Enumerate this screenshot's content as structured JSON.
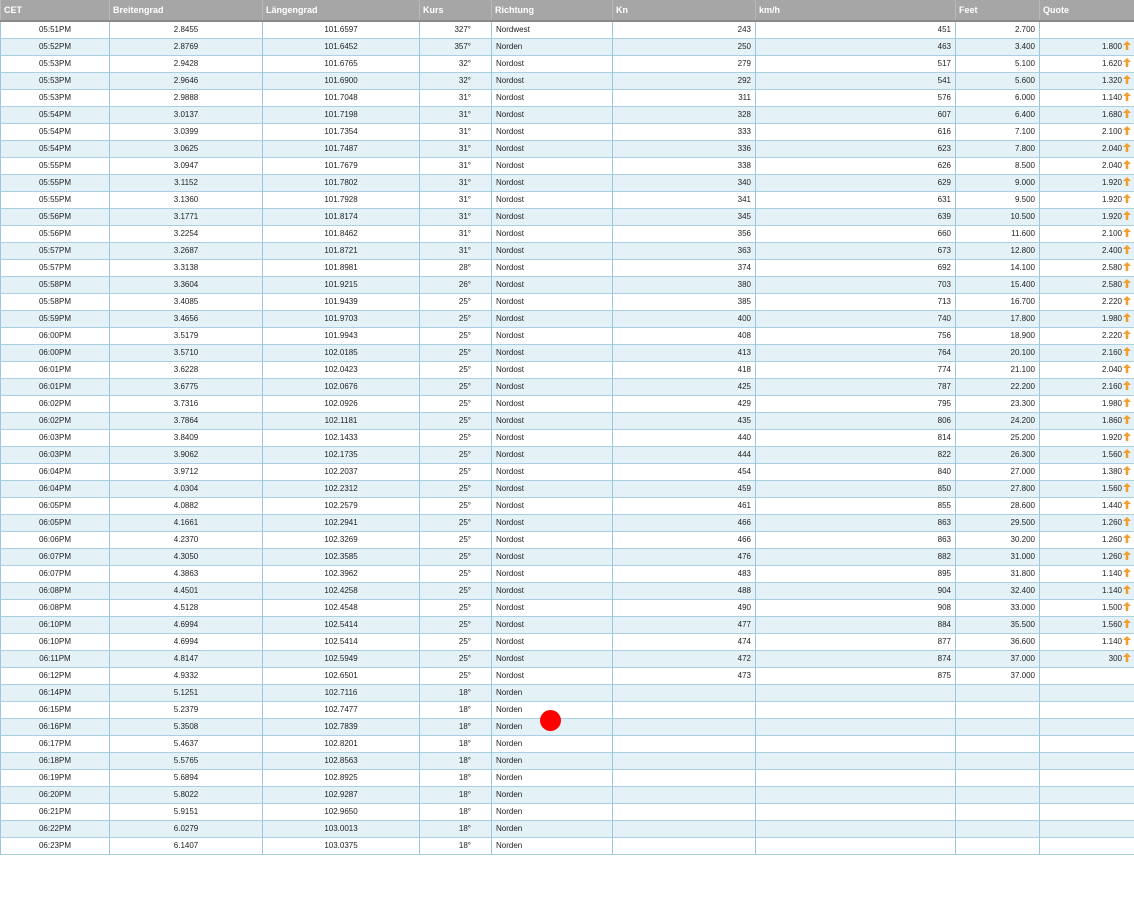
{
  "columns": {
    "time": "CET",
    "lat": "Breitengrad",
    "lon": "Längengrad",
    "course": "Kurs",
    "direction": "Richtung",
    "kn": "Kn",
    "kmh": "km/h",
    "feet": "Feet",
    "quote": "Quote"
  },
  "arrow_color": "#f0a030",
  "cursor_color": "#ff0000",
  "rows": [
    {
      "time": "05:51PM",
      "lat": "2.8455",
      "lon": "101.6597",
      "course": "327°",
      "dir": "Nordwest",
      "kn": "243",
      "kmh": "451",
      "feet": "2.700",
      "quote": "",
      "up": false
    },
    {
      "time": "05:52PM",
      "lat": "2.8769",
      "lon": "101.6452",
      "course": "357°",
      "dir": "Norden",
      "kn": "250",
      "kmh": "463",
      "feet": "3.400",
      "quote": "1.800",
      "up": true
    },
    {
      "time": "05:53PM",
      "lat": "2.9428",
      "lon": "101.6765",
      "course": "32°",
      "dir": "Nordost",
      "kn": "279",
      "kmh": "517",
      "feet": "5.100",
      "quote": "1.620",
      "up": true
    },
    {
      "time": "05:53PM",
      "lat": "2.9646",
      "lon": "101.6900",
      "course": "32°",
      "dir": "Nordost",
      "kn": "292",
      "kmh": "541",
      "feet": "5.600",
      "quote": "1.320",
      "up": true
    },
    {
      "time": "05:53PM",
      "lat": "2.9888",
      "lon": "101.7048",
      "course": "31°",
      "dir": "Nordost",
      "kn": "311",
      "kmh": "576",
      "feet": "6.000",
      "quote": "1.140",
      "up": true
    },
    {
      "time": "05:54PM",
      "lat": "3.0137",
      "lon": "101.7198",
      "course": "31°",
      "dir": "Nordost",
      "kn": "328",
      "kmh": "607",
      "feet": "6.400",
      "quote": "1.680",
      "up": true
    },
    {
      "time": "05:54PM",
      "lat": "3.0399",
      "lon": "101.7354",
      "course": "31°",
      "dir": "Nordost",
      "kn": "333",
      "kmh": "616",
      "feet": "7.100",
      "quote": "2.100",
      "up": true
    },
    {
      "time": "05:54PM",
      "lat": "3.0625",
      "lon": "101.7487",
      "course": "31°",
      "dir": "Nordost",
      "kn": "336",
      "kmh": "623",
      "feet": "7.800",
      "quote": "2.040",
      "up": true
    },
    {
      "time": "05:55PM",
      "lat": "3.0947",
      "lon": "101.7679",
      "course": "31°",
      "dir": "Nordost",
      "kn": "338",
      "kmh": "626",
      "feet": "8.500",
      "quote": "2.040",
      "up": true
    },
    {
      "time": "05:55PM",
      "lat": "3.1152",
      "lon": "101.7802",
      "course": "31°",
      "dir": "Nordost",
      "kn": "340",
      "kmh": "629",
      "feet": "9.000",
      "quote": "1.920",
      "up": true
    },
    {
      "time": "05:55PM",
      "lat": "3.1360",
      "lon": "101.7928",
      "course": "31°",
      "dir": "Nordost",
      "kn": "341",
      "kmh": "631",
      "feet": "9.500",
      "quote": "1.920",
      "up": true
    },
    {
      "time": "05:56PM",
      "lat": "3.1771",
      "lon": "101.8174",
      "course": "31°",
      "dir": "Nordost",
      "kn": "345",
      "kmh": "639",
      "feet": "10.500",
      "quote": "1.920",
      "up": true
    },
    {
      "time": "05:56PM",
      "lat": "3.2254",
      "lon": "101.8462",
      "course": "31°",
      "dir": "Nordost",
      "kn": "356",
      "kmh": "660",
      "feet": "11.600",
      "quote": "2.100",
      "up": true
    },
    {
      "time": "05:57PM",
      "lat": "3.2687",
      "lon": "101.8721",
      "course": "31°",
      "dir": "Nordost",
      "kn": "363",
      "kmh": "673",
      "feet": "12.800",
      "quote": "2.400",
      "up": true
    },
    {
      "time": "05:57PM",
      "lat": "3.3138",
      "lon": "101.8981",
      "course": "28°",
      "dir": "Nordost",
      "kn": "374",
      "kmh": "692",
      "feet": "14.100",
      "quote": "2.580",
      "up": true
    },
    {
      "time": "05:58PM",
      "lat": "3.3604",
      "lon": "101.9215",
      "course": "26°",
      "dir": "Nordost",
      "kn": "380",
      "kmh": "703",
      "feet": "15.400",
      "quote": "2.580",
      "up": true
    },
    {
      "time": "05:58PM",
      "lat": "3.4085",
      "lon": "101.9439",
      "course": "25°",
      "dir": "Nordost",
      "kn": "385",
      "kmh": "713",
      "feet": "16.700",
      "quote": "2.220",
      "up": true
    },
    {
      "time": "05:59PM",
      "lat": "3.4656",
      "lon": "101.9703",
      "course": "25°",
      "dir": "Nordost",
      "kn": "400",
      "kmh": "740",
      "feet": "17.800",
      "quote": "1.980",
      "up": true
    },
    {
      "time": "06:00PM",
      "lat": "3.5179",
      "lon": "101.9943",
      "course": "25°",
      "dir": "Nordost",
      "kn": "408",
      "kmh": "756",
      "feet": "18.900",
      "quote": "2.220",
      "up": true
    },
    {
      "time": "06:00PM",
      "lat": "3.5710",
      "lon": "102.0185",
      "course": "25°",
      "dir": "Nordost",
      "kn": "413",
      "kmh": "764",
      "feet": "20.100",
      "quote": "2.160",
      "up": true
    },
    {
      "time": "06:01PM",
      "lat": "3.6228",
      "lon": "102.0423",
      "course": "25°",
      "dir": "Nordost",
      "kn": "418",
      "kmh": "774",
      "feet": "21.100",
      "quote": "2.040",
      "up": true
    },
    {
      "time": "06:01PM",
      "lat": "3.6775",
      "lon": "102.0676",
      "course": "25°",
      "dir": "Nordost",
      "kn": "425",
      "kmh": "787",
      "feet": "22.200",
      "quote": "2.160",
      "up": true
    },
    {
      "time": "06:02PM",
      "lat": "3.7316",
      "lon": "102.0926",
      "course": "25°",
      "dir": "Nordost",
      "kn": "429",
      "kmh": "795",
      "feet": "23.300",
      "quote": "1.980",
      "up": true
    },
    {
      "time": "06:02PM",
      "lat": "3.7864",
      "lon": "102.1181",
      "course": "25°",
      "dir": "Nordost",
      "kn": "435",
      "kmh": "806",
      "feet": "24.200",
      "quote": "1.860",
      "up": true
    },
    {
      "time": "06:03PM",
      "lat": "3.8409",
      "lon": "102.1433",
      "course": "25°",
      "dir": "Nordost",
      "kn": "440",
      "kmh": "814",
      "feet": "25.200",
      "quote": "1.920",
      "up": true
    },
    {
      "time": "06:03PM",
      "lat": "3.9062",
      "lon": "102.1735",
      "course": "25°",
      "dir": "Nordost",
      "kn": "444",
      "kmh": "822",
      "feet": "26.300",
      "quote": "1.560",
      "up": true
    },
    {
      "time": "06:04PM",
      "lat": "3.9712",
      "lon": "102.2037",
      "course": "25°",
      "dir": "Nordost",
      "kn": "454",
      "kmh": "840",
      "feet": "27.000",
      "quote": "1.380",
      "up": true
    },
    {
      "time": "06:04PM",
      "lat": "4.0304",
      "lon": "102.2312",
      "course": "25°",
      "dir": "Nordost",
      "kn": "459",
      "kmh": "850",
      "feet": "27.800",
      "quote": "1.560",
      "up": true
    },
    {
      "time": "06:05PM",
      "lat": "4.0882",
      "lon": "102.2579",
      "course": "25°",
      "dir": "Nordost",
      "kn": "461",
      "kmh": "855",
      "feet": "28.600",
      "quote": "1.440",
      "up": true
    },
    {
      "time": "06:05PM",
      "lat": "4.1661",
      "lon": "102.2941",
      "course": "25°",
      "dir": "Nordost",
      "kn": "466",
      "kmh": "863",
      "feet": "29.500",
      "quote": "1.260",
      "up": true
    },
    {
      "time": "06:06PM",
      "lat": "4.2370",
      "lon": "102.3269",
      "course": "25°",
      "dir": "Nordost",
      "kn": "466",
      "kmh": "863",
      "feet": "30.200",
      "quote": "1.260",
      "up": true
    },
    {
      "time": "06:07PM",
      "lat": "4.3050",
      "lon": "102.3585",
      "course": "25°",
      "dir": "Nordost",
      "kn": "476",
      "kmh": "882",
      "feet": "31.000",
      "quote": "1.260",
      "up": true
    },
    {
      "time": "06:07PM",
      "lat": "4.3863",
      "lon": "102.3962",
      "course": "25°",
      "dir": "Nordost",
      "kn": "483",
      "kmh": "895",
      "feet": "31.800",
      "quote": "1.140",
      "up": true
    },
    {
      "time": "06:08PM",
      "lat": "4.4501",
      "lon": "102.4258",
      "course": "25°",
      "dir": "Nordost",
      "kn": "488",
      "kmh": "904",
      "feet": "32.400",
      "quote": "1.140",
      "up": true
    },
    {
      "time": "06:08PM",
      "lat": "4.5128",
      "lon": "102.4548",
      "course": "25°",
      "dir": "Nordost",
      "kn": "490",
      "kmh": "908",
      "feet": "33.000",
      "quote": "1.500",
      "up": true
    },
    {
      "time": "06:10PM",
      "lat": "4.6994",
      "lon": "102.5414",
      "course": "25°",
      "dir": "Nordost",
      "kn": "477",
      "kmh": "884",
      "feet": "35.500",
      "quote": "1.560",
      "up": true
    },
    {
      "time": "06:10PM",
      "lat": "4.6994",
      "lon": "102.5414",
      "course": "25°",
      "dir": "Nordost",
      "kn": "474",
      "kmh": "877",
      "feet": "36.600",
      "quote": "1.140",
      "up": true
    },
    {
      "time": "06:11PM",
      "lat": "4.8147",
      "lon": "102.5949",
      "course": "25°",
      "dir": "Nordost",
      "kn": "472",
      "kmh": "874",
      "feet": "37.000",
      "quote": "300",
      "up": true
    },
    {
      "time": "06:12PM",
      "lat": "4.9332",
      "lon": "102.6501",
      "course": "25°",
      "dir": "Nordost",
      "kn": "473",
      "kmh": "875",
      "feet": "37.000",
      "quote": "",
      "up": false
    },
    {
      "time": "06:14PM",
      "lat": "5.1251",
      "lon": "102.7116",
      "course": "18°",
      "dir": "Norden",
      "kn": "",
      "kmh": "",
      "feet": "",
      "quote": "",
      "up": false
    },
    {
      "time": "06:15PM",
      "lat": "5.2379",
      "lon": "102.7477",
      "course": "18°",
      "dir": "Norden",
      "kn": "",
      "kmh": "",
      "feet": "",
      "quote": "",
      "up": false
    },
    {
      "time": "06:16PM",
      "lat": "5.3508",
      "lon": "102.7839",
      "course": "18°",
      "dir": "Norden",
      "kn": "",
      "kmh": "",
      "feet": "",
      "quote": "",
      "up": false
    },
    {
      "time": "06:17PM",
      "lat": "5.4637",
      "lon": "102.8201",
      "course": "18°",
      "dir": "Norden",
      "kn": "",
      "kmh": "",
      "feet": "",
      "quote": "",
      "up": false
    },
    {
      "time": "06:18PM",
      "lat": "5.5765",
      "lon": "102.8563",
      "course": "18°",
      "dir": "Norden",
      "kn": "",
      "kmh": "",
      "feet": "",
      "quote": "",
      "up": false
    },
    {
      "time": "06:19PM",
      "lat": "5.6894",
      "lon": "102.8925",
      "course": "18°",
      "dir": "Norden",
      "kn": "",
      "kmh": "",
      "feet": "",
      "quote": "",
      "up": false
    },
    {
      "time": "06:20PM",
      "lat": "5.8022",
      "lon": "102.9287",
      "course": "18°",
      "dir": "Norden",
      "kn": "",
      "kmh": "",
      "feet": "",
      "quote": "",
      "up": false
    },
    {
      "time": "06:21PM",
      "lat": "5.9151",
      "lon": "102.9650",
      "course": "18°",
      "dir": "Norden",
      "kn": "",
      "kmh": "",
      "feet": "",
      "quote": "",
      "up": false
    },
    {
      "time": "06:22PM",
      "lat": "6.0279",
      "lon": "103.0013",
      "course": "18°",
      "dir": "Norden",
      "kn": "",
      "kmh": "",
      "feet": "",
      "quote": "",
      "up": false
    },
    {
      "time": "06:23PM",
      "lat": "6.1407",
      "lon": "103.0375",
      "course": "18°",
      "dir": "Norden",
      "kn": "",
      "kmh": "",
      "feet": "",
      "quote": "",
      "up": false
    }
  ]
}
